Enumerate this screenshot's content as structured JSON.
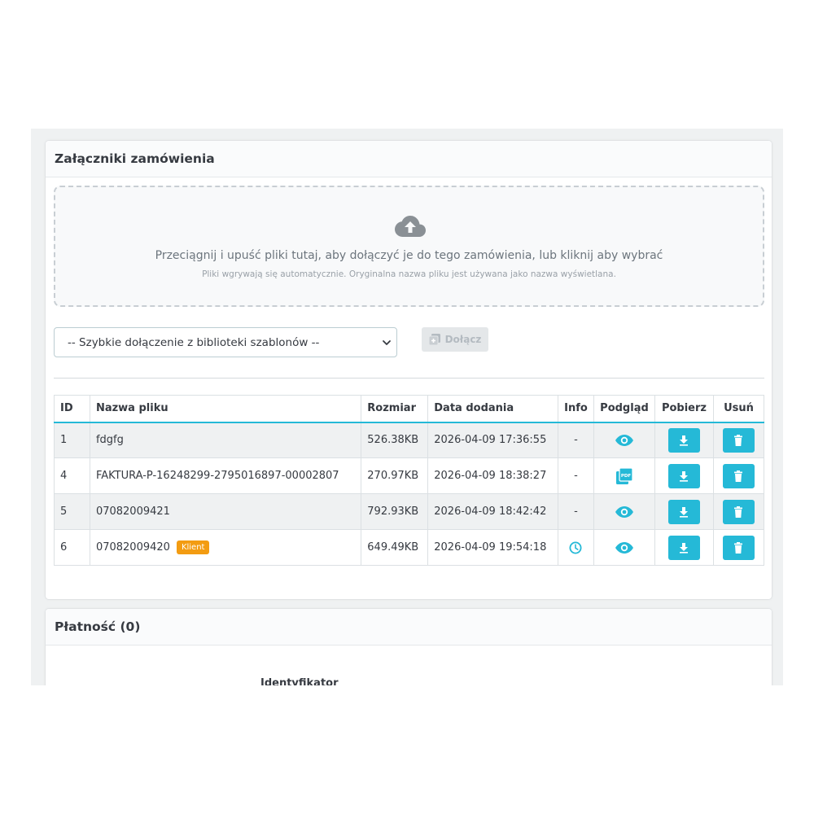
{
  "attachments": {
    "title": "Załączniki zamówienia",
    "dropzone": {
      "icon": "cloud-upload-icon",
      "main_text": "Przeciągnij i upuść pliki tutaj, aby dołączyć je do tego zamówienia, lub kliknij aby wybrać",
      "sub_text": "Pliki wgrywają się automatycznie. Oryginalna nazwa pliku jest używana jako nazwa wyświetlana."
    },
    "template_select": {
      "selected": "-- Szybkie dołączenie z biblioteki szablonów --"
    },
    "attach_button": {
      "label": "Dołącz"
    },
    "table": {
      "headers": {
        "id": "ID",
        "name": "Nazwa pliku",
        "size": "Rozmiar",
        "date": "Data dodania",
        "info": "Info",
        "preview": "Podgląd",
        "download": "Pobierz",
        "delete": "Usuń"
      },
      "rows": [
        {
          "id": "1",
          "name": "fdgfg",
          "badge": "",
          "size": "526.38KB",
          "date": "2026-04-09 17:36:55",
          "info": "-",
          "preview": "eye-icon"
        },
        {
          "id": "4",
          "name": "FAKTURA-P-16248299-2795016897-00002807",
          "badge": "",
          "size": "270.97KB",
          "date": "2026-04-09 18:38:27",
          "info": "-",
          "preview": "pdf-icon"
        },
        {
          "id": "5",
          "name": "07082009421",
          "badge": "",
          "size": "792.93KB",
          "date": "2026-04-09 18:42:42",
          "info": "-",
          "preview": "eye-icon"
        },
        {
          "id": "6",
          "name": "07082009420",
          "badge": "Klient",
          "size": "649.49KB",
          "date": "2026-04-09 19:54:18",
          "info": "",
          "info_icon": "clock-icon",
          "preview": "eye-icon"
        }
      ]
    }
  },
  "payment": {
    "title": "Płatność (0)",
    "column_label": "Identyfikator"
  },
  "colors": {
    "accent": "#25b9d7",
    "badge": "#f39c12",
    "background": "#eff1f2"
  }
}
